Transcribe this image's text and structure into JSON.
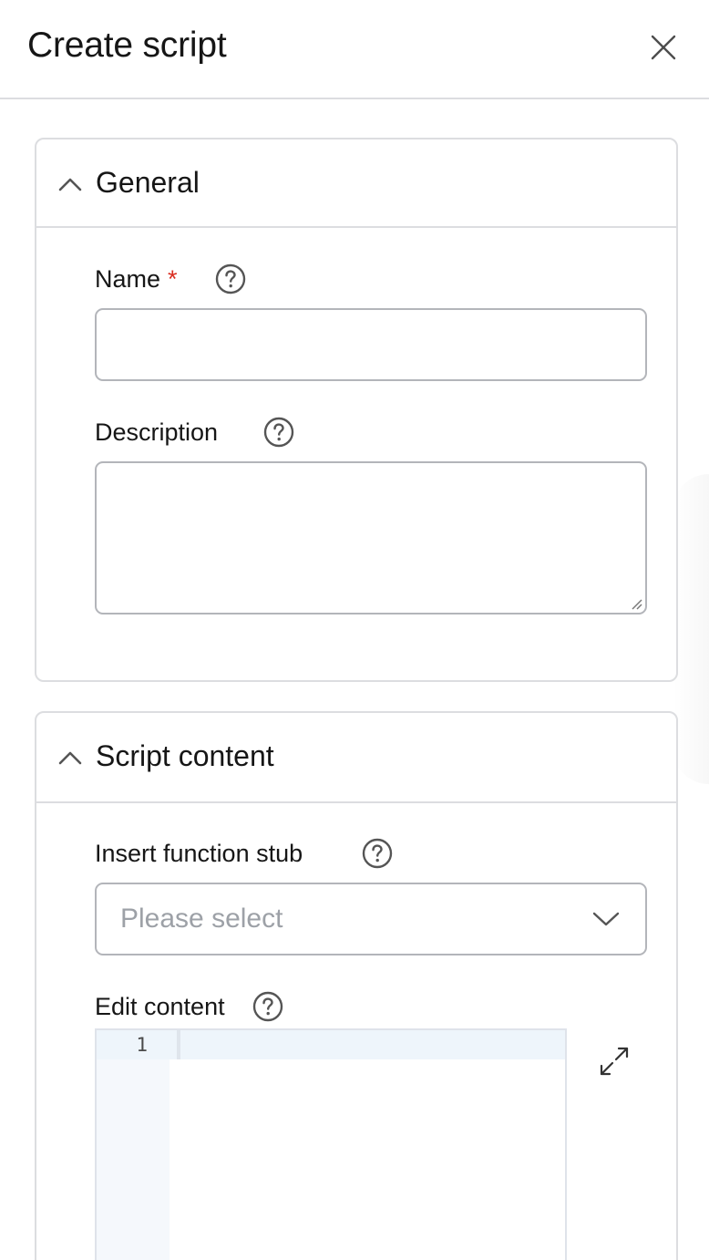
{
  "header": {
    "title": "Create script",
    "close_icon": "close-icon"
  },
  "general": {
    "title": "General",
    "expanded": true,
    "name_field": {
      "label": "Name",
      "required_marker": "*",
      "value": "",
      "help_icon": "question-circle-icon"
    },
    "description_field": {
      "label": "Description",
      "value": "",
      "help_icon": "question-circle-icon"
    }
  },
  "script_content": {
    "title": "Script content",
    "expanded": true,
    "function_stub": {
      "label": "Insert function stub",
      "placeholder": "Please select",
      "help_icon": "question-circle-icon"
    },
    "editor": {
      "label": "Edit content",
      "help_icon": "question-circle-icon",
      "line_numbers": [
        "1"
      ],
      "expand_icon": "expand-arrows-icon"
    }
  },
  "colors": {
    "text": "#161616",
    "required": "#d92d20",
    "border": "#dcdde0",
    "input_border": "#b3b5ba",
    "placeholder": "#9da1a7",
    "editor_gutter": "#f5f8fc",
    "active_line": "#eef5fb"
  }
}
